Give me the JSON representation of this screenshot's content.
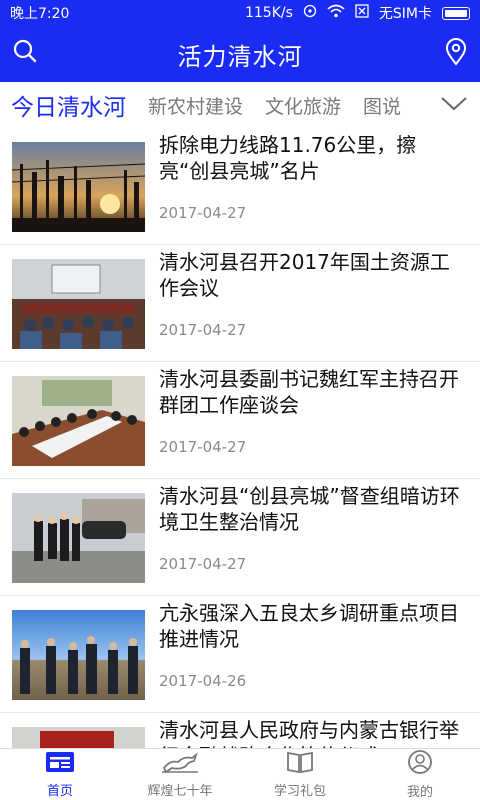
{
  "status_bar": {
    "time": "晚上7:20",
    "speed": "115K/s",
    "sim": "无SIM卡"
  },
  "app_bar": {
    "title": "活力清水河",
    "left_icon": "search-icon",
    "right_icon": "location-pin-icon"
  },
  "tabs": [
    {
      "label": "今日清水河",
      "active": true
    },
    {
      "label": "新农村建设",
      "active": false
    },
    {
      "label": "文化旅游",
      "active": false
    },
    {
      "label": "图说",
      "active": false
    }
  ],
  "news": [
    {
      "title": "拆除电力线路11.76公里，擦亮“创县亮城”名片",
      "date": "2017-04-27",
      "image": "sunset-power-lines"
    },
    {
      "title": "清水河县召开2017年国土资源工作会议",
      "date": "2017-04-27",
      "image": "meeting-room"
    },
    {
      "title": "清水河县委副书记魏红军主持召开群团工作座谈会",
      "date": "2017-04-27",
      "image": "conference-table"
    },
    {
      "title": "清水河县“创县亮城”督查组暗访环境卫生整治情况",
      "date": "2017-04-27",
      "image": "inspection-group"
    },
    {
      "title": "亢永强深入五良太乡调研重点项目推进情况",
      "date": "2017-04-26",
      "image": "field-visit"
    },
    {
      "title": "清水河县人民政府与内蒙古银行举行金融战略合作签约仪式",
      "date": "",
      "image": "signing-ceremony"
    }
  ],
  "bottom_nav": [
    {
      "label": "首页",
      "icon": "news-icon",
      "active": true
    },
    {
      "label": "辉煌七十年",
      "icon": "horse-icon",
      "active": false
    },
    {
      "label": "学习礼包",
      "icon": "book-icon",
      "active": false
    },
    {
      "label": "我的",
      "icon": "user-icon",
      "active": false
    }
  ],
  "colors": {
    "brand": "#1a2cf3",
    "text": "#111111",
    "muted": "#8a8a8a"
  }
}
